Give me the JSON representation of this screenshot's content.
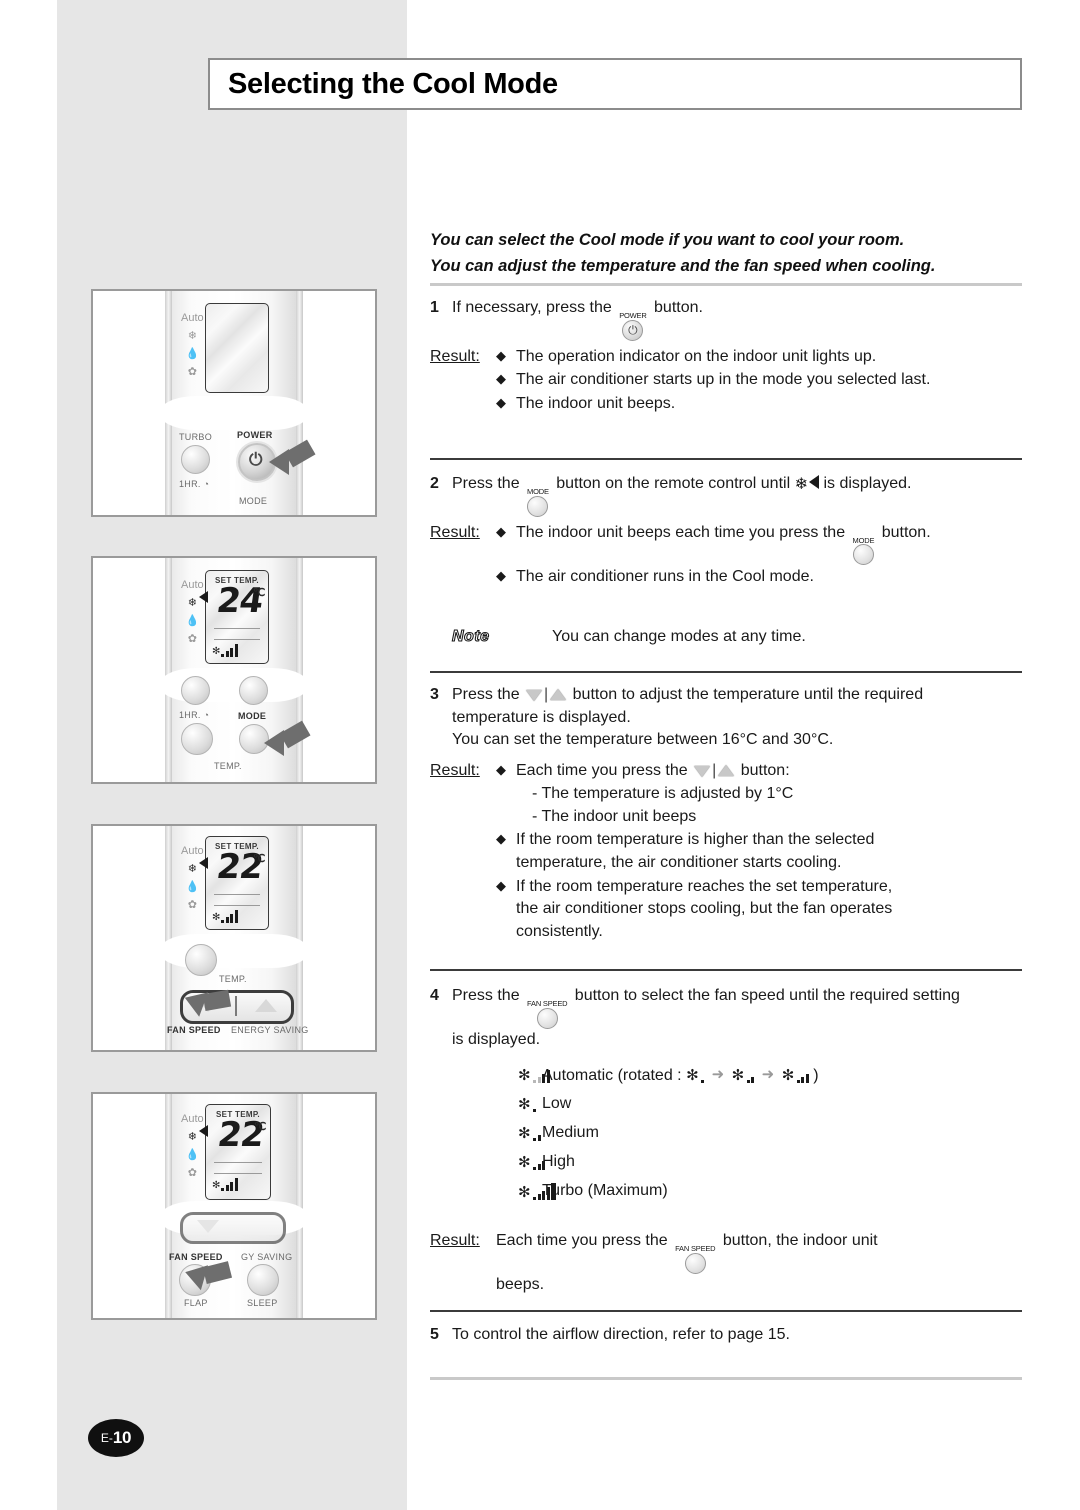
{
  "page": {
    "title": "Selecting the Cool Mode",
    "page_marker_prefix": "E-",
    "page_marker_number": "10"
  },
  "intro": {
    "line1": "You can select the Cool mode if you want to cool your room.",
    "line2": "You can adjust the temperature and the fan speed when cooling."
  },
  "steps": {
    "s1": {
      "num": "1",
      "text_before": "If necessary, press the",
      "button_cap": "POWER",
      "button_glyph": "⏻",
      "text_after": "button.",
      "result_label": "Result:",
      "bullets": [
        "The operation indicator on the indoor unit lights up.",
        "The air conditioner starts up in the mode you selected last.",
        "The indoor unit beeps."
      ]
    },
    "s2": {
      "num": "2",
      "text_before": "Press the",
      "button_cap": "MODE",
      "text_mid": "button on the remote control until",
      "symbol": "❄",
      "text_after": "is displayed.",
      "result_label": "Result:",
      "bullet1_before": "The indoor unit beeps each time you press the",
      "bullet1_cap": "MODE",
      "bullet1_after": "button.",
      "bullet2": "The air conditioner runs in the Cool mode.",
      "note_word": "Note",
      "note_text": "You can change modes at any time."
    },
    "s3": {
      "num": "3",
      "text_before": "Press the",
      "text_mid": "button to adjust the temperature until the required",
      "line2": "temperature is displayed.",
      "line3": "You can set the temperature between 16°C and 30°C.",
      "result_label": "Result:",
      "b1_before": "Each time you press the",
      "b1_after": "button:",
      "b1_sub1": "- The temperature is adjusted by 1°C",
      "b1_sub2": "- The indoor unit beeps",
      "b2_l1": "If the room temperature is higher than the selected",
      "b2_l2": "temperature, the air conditioner starts cooling.",
      "b3_l1": "If the room temperature reaches the set temperature,",
      "b3_l2": "the air conditioner stops cooling, but the fan operates",
      "b3_l3": "consistently."
    },
    "s4": {
      "num": "4",
      "text_before": "Press the",
      "button_cap": "FAN SPEED",
      "text_after": "button to select the fan speed until the required setting",
      "line2": "is displayed.",
      "speeds": [
        {
          "label": "Automatic (rotated :",
          "bars": 3,
          "gray": true,
          "rotated": true,
          "close": ")"
        },
        {
          "label": "Low",
          "bars": 1,
          "gray": false,
          "rotated": false
        },
        {
          "label": "Medium",
          "bars": 2,
          "gray": false,
          "rotated": false
        },
        {
          "label": "High",
          "bars": 3,
          "gray": false,
          "rotated": false
        },
        {
          "label": "Turbo (Maximum)",
          "bars": 4,
          "gray": false,
          "rotated": false
        }
      ],
      "result_label": "Result:",
      "result_before": "Each time you press the",
      "result_cap": "FAN SPEED",
      "result_after": "button, the indoor unit",
      "result_line2": "beeps."
    },
    "s5": {
      "num": "5",
      "text": "To control the airflow direction, refer to page 15."
    }
  },
  "panels": {
    "p1": {
      "modes": [
        "Auto",
        "❄",
        "💧",
        "✿"
      ],
      "turbo_label": "TURBO",
      "power_label": "POWER",
      "hr_label": "1HR.",
      "mode_label": "MODE",
      "power_glyph": "⏻"
    },
    "p2": {
      "set_temp_label": "SET TEMP.",
      "temperature": "24",
      "unit": "℃",
      "hr_label": "1HR.",
      "mode_label": "MODE",
      "temp_label": "TEMP."
    },
    "p3": {
      "set_temp_label": "SET TEMP.",
      "temperature": "22",
      "unit": "℃",
      "temp_label": "TEMP.",
      "fan_speed_label": "FAN SPEED",
      "energy_saving_label": "ENERGY SAVING"
    },
    "p4": {
      "set_temp_label": "SET TEMP.",
      "temperature": "22",
      "unit": "℃",
      "fan_speed_label": "FAN SPEED",
      "energy_saving_label": "GY SAVING",
      "flap_label": "FLAP",
      "sleep_label": "SLEEP"
    }
  },
  "colors": {
    "band": "#e6e6e6",
    "rule_dark": "#3b3b3b",
    "rule_light": "#c9c9c9",
    "badge": "#101010"
  }
}
